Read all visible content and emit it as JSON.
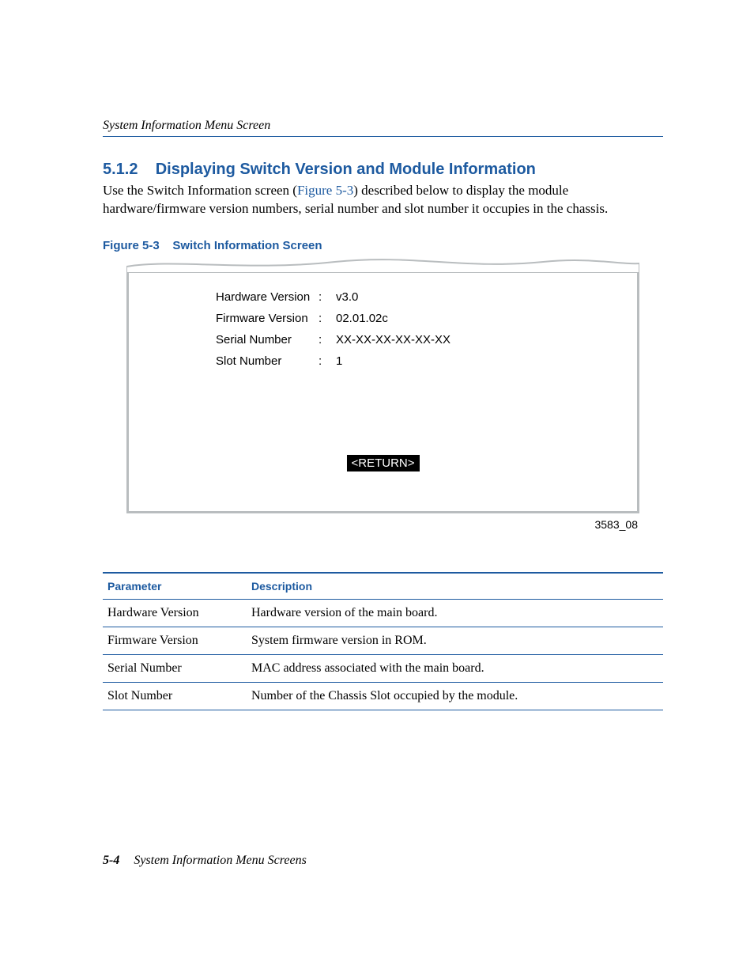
{
  "running_header": "System Information Menu Screen",
  "heading_number": "5.1.2",
  "heading_title": "Displaying Switch Version and Module Information",
  "intro_pre": "Use the Switch Information screen (",
  "intro_link": "Figure 5-3",
  "intro_post": ") described below to display the module hardware/firmware version numbers, serial number and slot number it occupies in the chassis.",
  "figure_caption_label": "Figure 5-3",
  "figure_caption_title": "Switch Information Screen",
  "screen": {
    "rows": [
      {
        "label": "Hardware Version",
        "value": "v3.0"
      },
      {
        "label": "Firmware Version",
        "value": "02.01.02c"
      },
      {
        "label": "Serial Number",
        "value": "XX-XX-XX-XX-XX-XX"
      },
      {
        "label": "Slot Number",
        "value": "1"
      }
    ],
    "return_label": "<RETURN>"
  },
  "figure_id": "3583_08",
  "table": {
    "headers": {
      "param": "Parameter",
      "desc": "Description"
    },
    "rows": [
      {
        "param": "Hardware Version",
        "desc": "Hardware version of the main board."
      },
      {
        "param": "Firmware Version",
        "desc": "System firmware version in ROM."
      },
      {
        "param": "Serial Number",
        "desc": "MAC address associated with the main board."
      },
      {
        "param": "Slot Number",
        "desc": "Number of the Chassis Slot occupied by the module."
      }
    ]
  },
  "footer_page": "5-4",
  "footer_text": "System Information Menu Screens"
}
